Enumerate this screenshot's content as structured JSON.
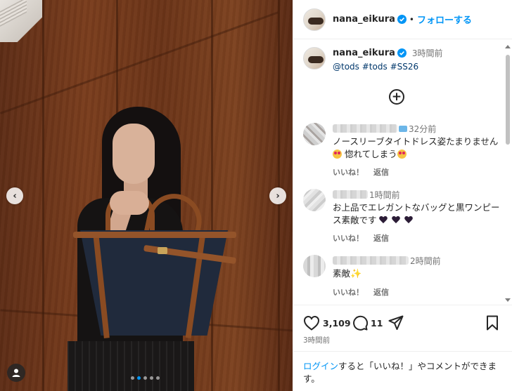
{
  "post": {
    "username": "nana_eikura",
    "follow_label": "フォローする",
    "separator": "•",
    "caption_time": "3時間前",
    "caption_tags": [
      "@tods",
      "#tods",
      "#SS26"
    ],
    "carousel": {
      "total_slides": 5,
      "active_index": 1
    }
  },
  "comments": [
    {
      "time": "32分前",
      "text_parts": [
        "ノースリーブタイトドレス姿たまりません",
        " 惚れてしまう",
        ""
      ],
      "like_label": "いいね！",
      "reply_label": "返信"
    },
    {
      "time": "1時間前",
      "text": "お上品でエレガントなバッグと黒ワンピース素敵です ",
      "like_label": "いいね！",
      "reply_label": "返信"
    },
    {
      "time": "2時間前",
      "text": "素敵",
      "like_label": "いいね！",
      "reply_label": "返信"
    }
  ],
  "actions": {
    "like_count": "3,109",
    "comment_count": "11",
    "posted_time": "3時間前"
  },
  "login": {
    "link_label": "ログイン",
    "rest_text": "すると「いいね！」やコメントができます。"
  },
  "colors": {
    "accent": "#0095f6",
    "verified": "#0095f6",
    "text": "#262626",
    "muted": "#737373"
  }
}
